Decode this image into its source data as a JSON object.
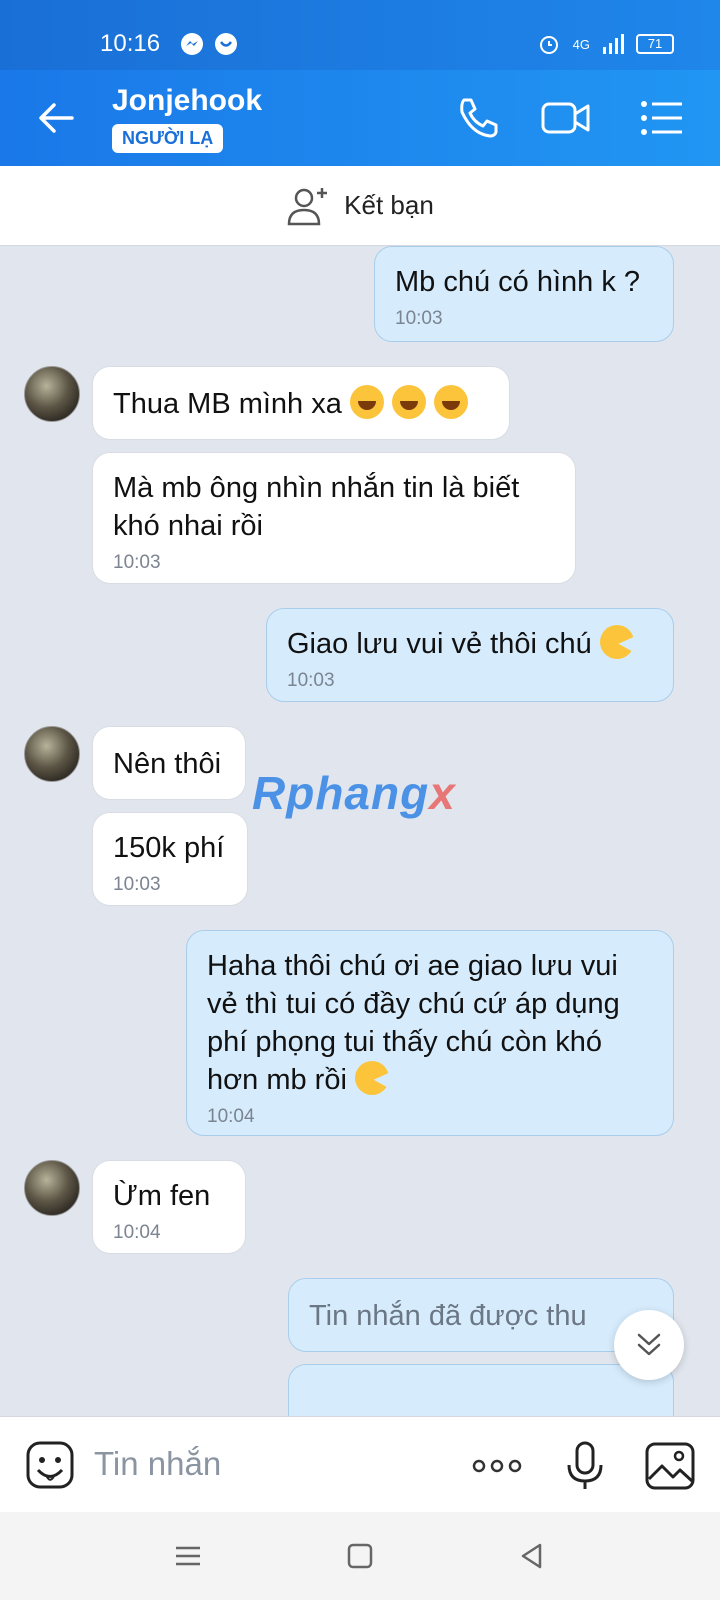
{
  "status_bar": {
    "time": "10:16",
    "network": "4G",
    "battery": "71"
  },
  "header": {
    "contact_name": "Jonjehook",
    "badge": "NGƯỜI LẠ"
  },
  "friend_bar": {
    "label": "Kết bạn"
  },
  "watermark": {
    "part1": "Rphang",
    "part2": "x"
  },
  "messages": [
    {
      "dir": "out",
      "text": "Mb chú có hình k ?",
      "time": "10:03"
    },
    {
      "dir": "in",
      "text": "Thua MB mình xa",
      "emojis": 3
    },
    {
      "dir": "in",
      "text": "Mà mb ông nhìn nhắn tin là biết khó nhai rồi",
      "time": "10:03"
    },
    {
      "dir": "out",
      "text": "Giao lưu vui vẻ thôi chú",
      "time": "10:03"
    },
    {
      "dir": "in",
      "text": "Nên thôi"
    },
    {
      "dir": "in",
      "text": "150k phí",
      "time": "10:03"
    },
    {
      "dir": "out",
      "text": "Haha thôi chú ơi ae giao lưu vui vẻ thì tui có đầy chú cứ áp dụng phí phọng tui thấy chú còn khó hơn mb rồi",
      "time": "10:04"
    },
    {
      "dir": "in",
      "text": "Ừm  fen",
      "time": "10:04"
    },
    {
      "dir": "out",
      "text": "Tin nhắn đã được thu",
      "recalled": true
    }
  ],
  "input": {
    "placeholder": "Tin nhắn"
  },
  "colors": {
    "header": "#1a78e8",
    "out_bubble": "#d6ecfd",
    "in_bubble": "#ffffff",
    "background": "#e1e6ee"
  }
}
